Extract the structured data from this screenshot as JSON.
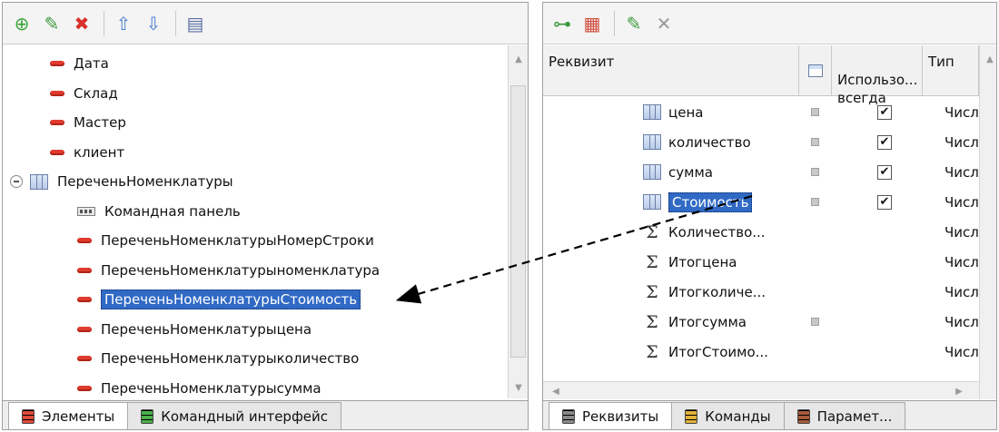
{
  "left_panel": {
    "toolbar": [
      {
        "name": "add-icon",
        "glyph": "⊕",
        "color": "#3aa53a"
      },
      {
        "name": "edit-icon",
        "glyph": "✎",
        "color": "#3c9a3c"
      },
      {
        "name": "delete-icon",
        "glyph": "✖",
        "color": "#d8302a"
      },
      {
        "name": "move-up-icon",
        "glyph": "⇧",
        "color": "#4a7fd0"
      },
      {
        "name": "move-down-icon",
        "glyph": "⇩",
        "color": "#4a7fd0"
      },
      {
        "name": "form-icon",
        "glyph": "▤",
        "color": "#5a6fa0"
      }
    ],
    "items": [
      {
        "label": "Дата",
        "icon": "minus-icon",
        "level": 1
      },
      {
        "label": "Склад",
        "icon": "minus-icon",
        "level": 1
      },
      {
        "label": "Мастер",
        "icon": "minus-icon",
        "level": 1
      },
      {
        "label": "клиент",
        "icon": "minus-icon",
        "level": 1
      },
      {
        "label": "ПереченьНоменклатуры",
        "icon": "table-icon",
        "level": 0
      },
      {
        "label": "Командная панель",
        "icon": "cmdpanel-icon",
        "level": 2
      },
      {
        "label": "ПереченьНоменклатурыНомерСтроки",
        "icon": "minus-icon",
        "level": 2
      },
      {
        "label": "ПереченьНоменклатурыноменклатура",
        "icon": "minus-icon",
        "level": 2
      },
      {
        "label": "ПереченьНоменклатурыСтоимость",
        "icon": "minus-icon",
        "level": 2,
        "selected": true
      },
      {
        "label": "ПереченьНоменклатурыцена",
        "icon": "minus-icon",
        "level": 2
      },
      {
        "label": "ПереченьНоменклатурыколичество",
        "icon": "minus-icon",
        "level": 2
      },
      {
        "label": "ПереченьНоменклатурысумма",
        "icon": "minus-icon",
        "level": 2
      }
    ],
    "tabs": [
      {
        "label": "Элементы",
        "color": "#e04a3a",
        "active": true
      },
      {
        "label": "Командный интерфейс",
        "color": "#4bb04b",
        "active": false
      }
    ]
  },
  "right_panel": {
    "toolbar": [
      {
        "name": "add-attribute-icon",
        "glyph": "⊶",
        "color": "#3c9a3c"
      },
      {
        "name": "add-table-icon",
        "glyph": "▦",
        "color": "#d04a3a"
      },
      {
        "name": "edit-icon",
        "glyph": "✎",
        "color": "#3c9a3c"
      },
      {
        "name": "delete-icon",
        "glyph": "✕",
        "color": "#9a9a9a"
      }
    ],
    "columns": {
      "attribute": "Реквизит",
      "always_use": "Использо...\nвсегда",
      "type": "Тип"
    },
    "rows": [
      {
        "label": "цена",
        "icon": "table-icon",
        "box": true,
        "checked": true,
        "type": "Числ"
      },
      {
        "label": "количество",
        "icon": "table-icon",
        "box": true,
        "checked": true,
        "type": "Числ"
      },
      {
        "label": "сумма",
        "icon": "table-icon",
        "box": true,
        "checked": true,
        "type": "Числ"
      },
      {
        "label": "Стоимость",
        "icon": "table-icon",
        "box": true,
        "checked": true,
        "type": "Числ",
        "selected": true
      },
      {
        "label": "Количество...",
        "icon": "sigma-icon",
        "box": false,
        "checked": false,
        "type": "Числ"
      },
      {
        "label": "Итогцена",
        "icon": "sigma-icon",
        "box": false,
        "checked": false,
        "type": "Числ"
      },
      {
        "label": "Итогколиче...",
        "icon": "sigma-icon",
        "box": false,
        "checked": false,
        "type": "Числ"
      },
      {
        "label": "Итогсумма",
        "icon": "sigma-icon",
        "box": true,
        "checked": false,
        "type": "Числ"
      },
      {
        "label": "ИтогСтоимо...",
        "icon": "sigma-icon",
        "box": false,
        "checked": false,
        "type": "Числ"
      }
    ],
    "check_glyph": "✔",
    "tabs": [
      {
        "label": "Реквизиты",
        "color": "#8a8a8a",
        "active": true
      },
      {
        "label": "Команды",
        "color": "#e0b23a",
        "active": false
      },
      {
        "label": "Парамет...",
        "color": "#a85a3a",
        "active": false
      }
    ]
  }
}
